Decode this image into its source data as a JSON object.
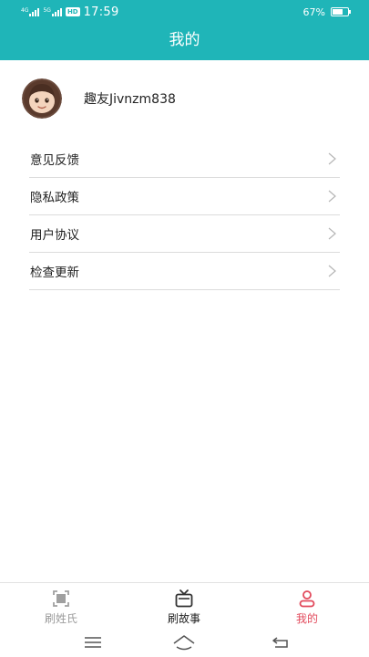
{
  "status_bar": {
    "net1_label": "4G",
    "net2_label": "5G",
    "hd_label": "HD",
    "time": "17:59",
    "battery_text": "67%",
    "battery_level": 0.67
  },
  "header": {
    "title": "我的"
  },
  "profile": {
    "username": "趣友Jivnzm838"
  },
  "menu": {
    "items": [
      {
        "label": "意见反馈"
      },
      {
        "label": "隐私政策"
      },
      {
        "label": "用户协议"
      },
      {
        "label": "检查更新"
      }
    ]
  },
  "tabs": {
    "items": [
      {
        "label": "刷姓氏",
        "icon": "scan-frame-icon"
      },
      {
        "label": "刷故事",
        "icon": "tv-icon"
      },
      {
        "label": "我的",
        "icon": "person-icon"
      }
    ],
    "active_index": 2,
    "active_color": "#e24a5c",
    "inactive_color": "#9a9a9a"
  },
  "colors": {
    "brand": "#1fb5b8",
    "divider": "#dcdcdc"
  }
}
